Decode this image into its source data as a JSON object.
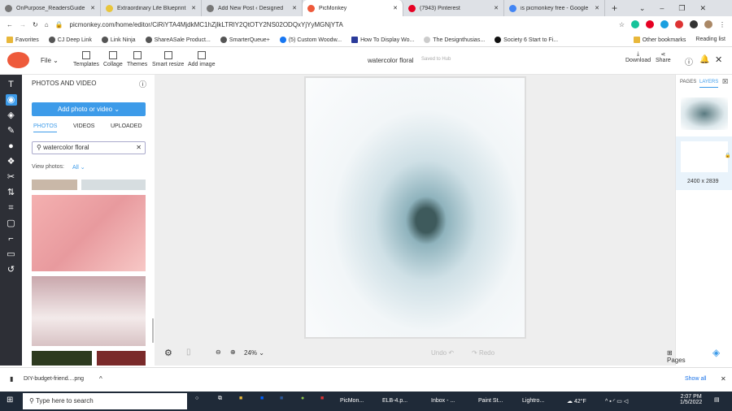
{
  "browser": {
    "tabs": [
      {
        "label": "OnPurpose_ReadersGuide"
      },
      {
        "label": "Extraordinary Life Blueprint"
      },
      {
        "label": "Add New Post ‹ Designed"
      },
      {
        "label": "PicMonkey",
        "active": true
      },
      {
        "label": "(7943) Pinterest"
      },
      {
        "label": "is picmonkey free - Google"
      }
    ],
    "url": "picmonkey.com/home/editor/CiRiYTA4MjdkMC1hZjlkLTRlY2QtOTY2NS02ODQxYjYyMGNjYTA",
    "bookmarks": [
      "Favorites",
      "CJ Deep Link",
      "Link Ninja",
      "ShareASale Product...",
      "SmarterQueue+",
      "(5) Custom Woodw...",
      "How To Display Wo...",
      "The Designthusias...",
      "Society 6 Start to Fi..."
    ],
    "other_bookmarks": "Other bookmarks",
    "reading_list": "Reading list"
  },
  "app": {
    "file": "File",
    "tools": [
      "Templates",
      "Collage",
      "Themes",
      "Smart resize",
      "Add image"
    ],
    "doc_title": "watercolor floral",
    "saved": "Saved to Hub",
    "download": "Download",
    "share": "Share",
    "accent": "#3d9be9"
  },
  "panel": {
    "title": "PHOTOS AND VIDEO",
    "add_button": "Add photo or video",
    "tabs": [
      "PHOTOS",
      "VIDEOS",
      "UPLOADED"
    ],
    "search_value": "watercolor floral",
    "view_label": "View photos:",
    "view_value": "All"
  },
  "right": {
    "pages": "PAGES",
    "layers": "LAYERS",
    "size": "2400 x 2839"
  },
  "bottom": {
    "zoom": "24%",
    "undo": "Undo",
    "redo": "Redo",
    "pages": "Pages"
  },
  "download_bar": {
    "file": "DIY-budget-friend....png",
    "show_all": "Show all"
  },
  "taskbar": {
    "search": "Type here to search",
    "apps": [
      "PicMon...",
      "ELB-4.p...",
      "Inbox - ...",
      "Paint St...",
      "Lightro..."
    ],
    "weather": "42°F",
    "time": "2:07 PM",
    "date": "1/5/2022"
  }
}
